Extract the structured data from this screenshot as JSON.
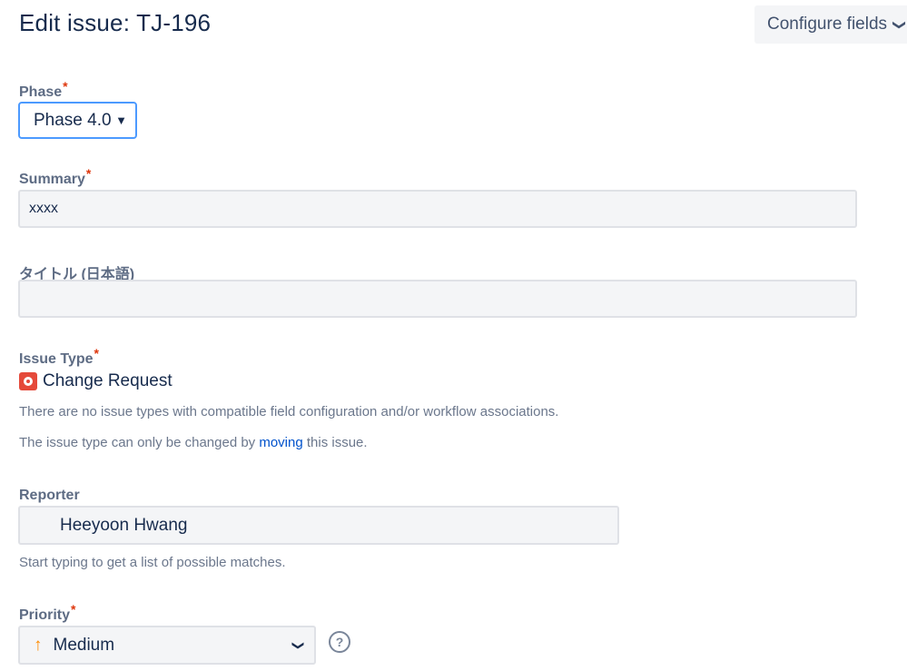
{
  "header": {
    "title": "Edit issue: TJ-196",
    "configure_fields_label": "Configure fields"
  },
  "fields": {
    "phase": {
      "label": "Phase",
      "value": "Phase 4.0"
    },
    "summary": {
      "label": "Summary",
      "value": "xxxx"
    },
    "title_japanese": {
      "label": "タイトル (日本語)",
      "value": ""
    },
    "issue_type": {
      "label": "Issue Type",
      "value": "Change Request",
      "note_line1": "There are no issue types with compatible field configuration and/or workflow associations.",
      "note_line2_prefix": "The issue type can only be changed by",
      "note_line2_link": "moving",
      "note_line2_suffix": "this issue."
    },
    "reporter": {
      "label": "Reporter",
      "value": "Heeyoon Hwang",
      "help": "Start typing to get a list of possible matches."
    },
    "priority": {
      "label": "Priority",
      "value": "Medium"
    }
  },
  "required_marker": "*",
  "icons": {
    "configure_chevron": "chevron-down-icon",
    "phase_caret": "caret-down-icon",
    "issue_type": "change-request-icon",
    "priority": "arrow-up-icon",
    "priority_chevron": "chevron-down-icon",
    "help": "question-circle-icon"
  },
  "colors": {
    "required": "#de350b",
    "link": "#0052cc",
    "focus_border": "#4c9aff",
    "change_request": "#e5493a",
    "priority_medium": "#ff8b00"
  }
}
